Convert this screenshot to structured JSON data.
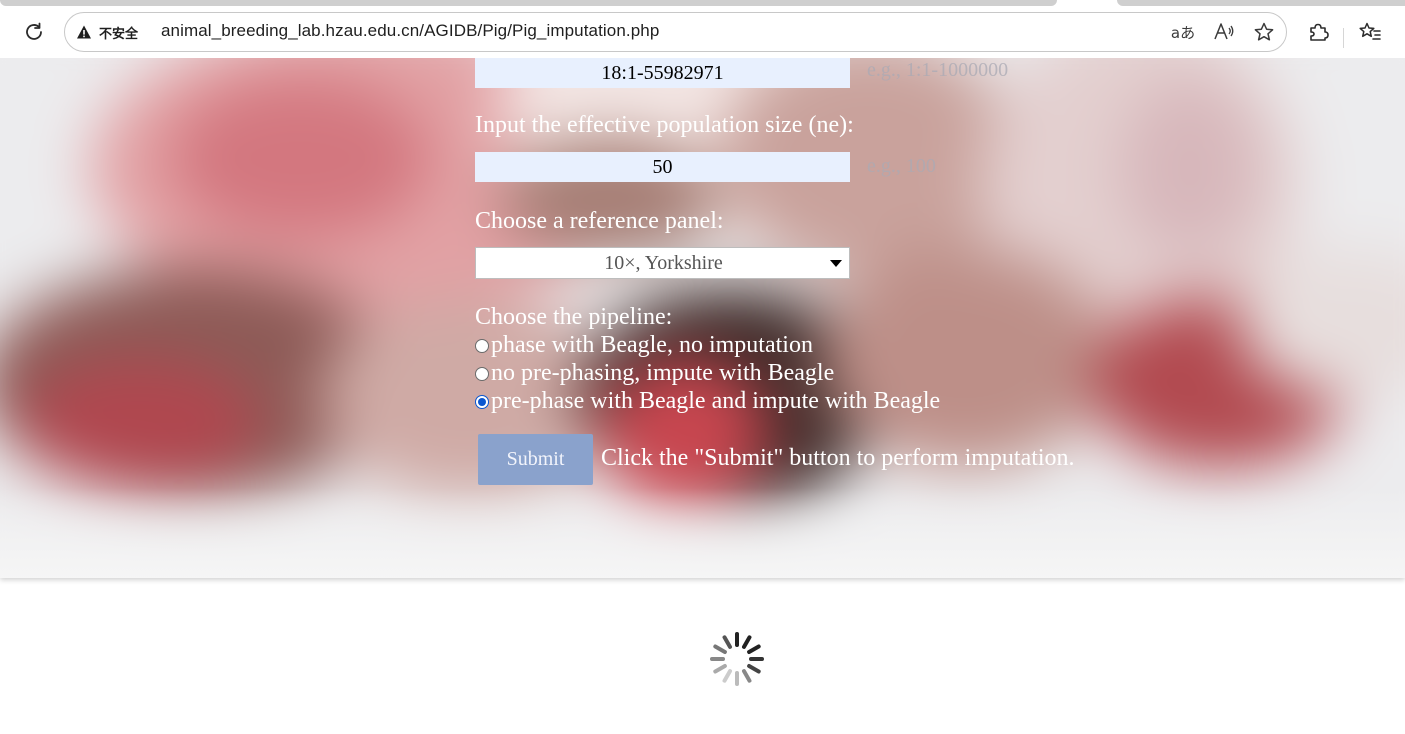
{
  "browser": {
    "security_label": "不安全",
    "url": "animal_breeding_lab.hzau.edu.cn/AGIDB/Pig/Pig_imputation.php",
    "translate_glyph": "aあ",
    "read_aloud_glyph": "A⁾"
  },
  "form": {
    "region": {
      "value": "18:1-55982971",
      "example": "e.g., 1:1-1000000"
    },
    "ne": {
      "label": "Input the effective population size (ne):",
      "value": "50",
      "example": "e.g., 100"
    },
    "panel": {
      "label": "Choose a reference panel:",
      "selected": "10×, Yorkshire"
    },
    "pipeline": {
      "label": "Choose the pipeline:",
      "options": [
        {
          "label": "phase with Beagle, no imputation",
          "checked": false
        },
        {
          "label": "no pre-phasing, impute with Beagle",
          "checked": false
        },
        {
          "label": "pre-phase with Beagle and impute with Beagle",
          "checked": true
        }
      ]
    },
    "submit": {
      "label": "Submit",
      "hint": "Click the \"Submit\" button to perform imputation."
    }
  },
  "colors": {
    "input_bg": "#e8f0fe",
    "submit_bg": "#8aa2cc",
    "radio_accent": "#0b57d0"
  }
}
